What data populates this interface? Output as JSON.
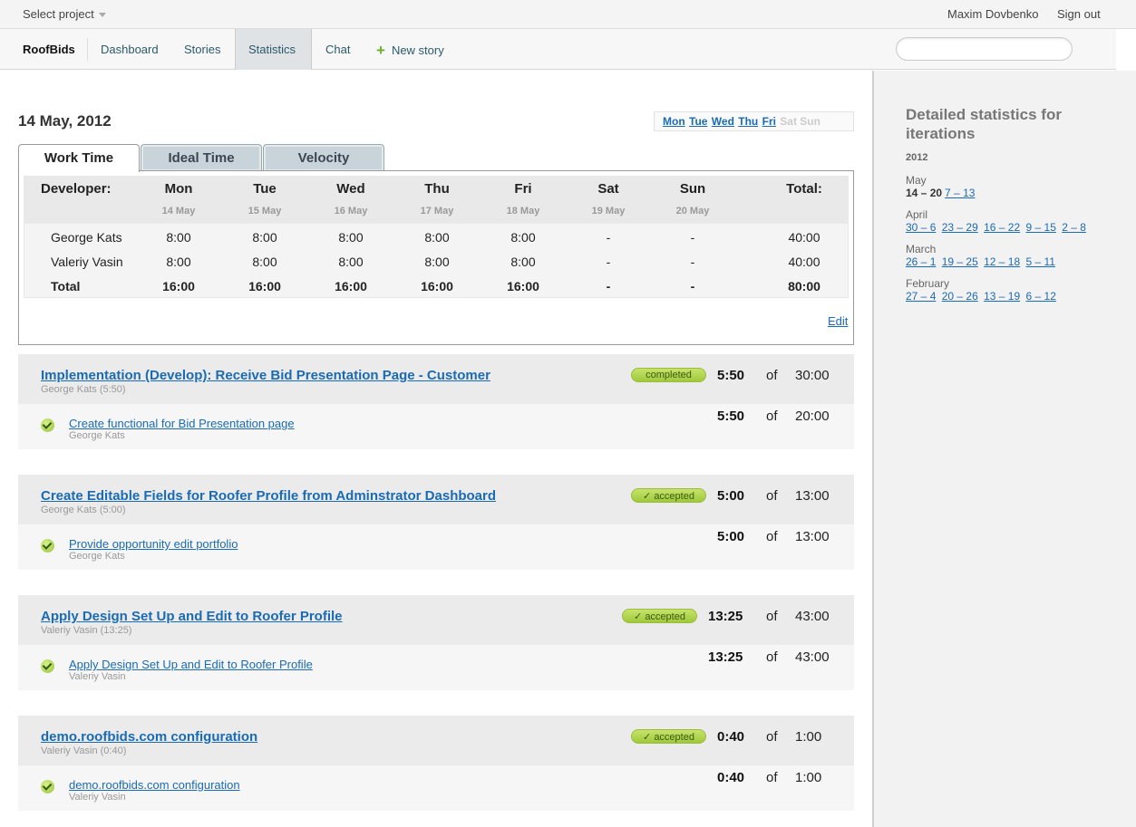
{
  "topbar": {
    "project_select": "Select project",
    "user": "Maxim Dovbenko",
    "signout": "Sign out"
  },
  "nav": {
    "brand": "RoofBids",
    "items": [
      "Dashboard",
      "Stories",
      "Statistics",
      "Chat"
    ],
    "new_story": "New story",
    "search_placeholder": ""
  },
  "main": {
    "date": "14 May, 2012",
    "days": {
      "on": [
        "Mon",
        "Tue",
        "Wed",
        "Thu",
        "Fri"
      ],
      "off": "Sat Sun"
    },
    "tabs": [
      "Work Time",
      "Ideal Time",
      "Velocity"
    ],
    "table": {
      "header": [
        "Developer:",
        "Mon",
        "Tue",
        "Wed",
        "Thu",
        "Fri",
        "Sat",
        "Sun",
        "Total:"
      ],
      "dates": [
        "14 May",
        "15 May",
        "16 May",
        "17 May",
        "18 May",
        "19 May",
        "20 May"
      ],
      "rows": [
        {
          "name": "George Kats",
          "values": [
            "8:00",
            "8:00",
            "8:00",
            "8:00",
            "8:00",
            "-",
            "-"
          ],
          "total": "40:00"
        },
        {
          "name": "Valeriy Vasin",
          "values": [
            "8:00",
            "8:00",
            "8:00",
            "8:00",
            "8:00",
            "-",
            "-"
          ],
          "total": "40:00"
        }
      ],
      "totals": {
        "label": "Total",
        "values": [
          "16:00",
          "16:00",
          "16:00",
          "16:00",
          "16:00",
          "-",
          "-"
        ],
        "total": "80:00"
      }
    },
    "edit": "Edit",
    "of": "of",
    "stories": [
      {
        "title": "Implementation (Develop): Receive Bid Presentation Page - Customer",
        "owner": "George Kats (5:50)",
        "status": "completed",
        "time": "5:50",
        "estimate": "30:00",
        "task": {
          "title": "Create functional for Bid Presentation page",
          "owner": "George Kats",
          "time": "5:50",
          "estimate": "20:00"
        }
      },
      {
        "title": "Create Editable Fields for Roofer Profile from Adminstrator Dashboard",
        "owner": "George Kats (5:00)",
        "status": "accepted",
        "time": "5:00",
        "estimate": "13:00",
        "task": {
          "title": "Provide opportunity edit portfolio",
          "owner": "George Kats",
          "time": "5:00",
          "estimate": "13:00"
        }
      },
      {
        "title": "Apply Design Set Up and Edit to Roofer Profile",
        "owner": "Valeriy Vasin (13:25)",
        "status": "accepted",
        "time": "13:25",
        "estimate": "43:00",
        "task": {
          "title": "Apply Design Set Up and Edit to Roofer Profile",
          "owner": "Valeriy Vasin",
          "time": "13:25",
          "estimate": "43:00"
        }
      },
      {
        "title": "demo.roofbids.com configuration",
        "owner": "Valeriy Vasin (0:40)",
        "status": "accepted",
        "time": "0:40",
        "estimate": "1:00",
        "task": {
          "title": "demo.roofbids.com configuration",
          "owner": "Valeriy Vasin",
          "time": "0:40",
          "estimate": "1:00"
        }
      }
    ]
  },
  "sidebar": {
    "title": "Detailed statistics for iterations",
    "year": "2012",
    "months": [
      {
        "name": "May",
        "current": "14 – 20",
        "links": [
          "7 – 13"
        ]
      },
      {
        "name": "April",
        "links": [
          "30 – 6",
          "23 – 29",
          "16 – 22",
          "9 – 15",
          "2 – 8"
        ]
      },
      {
        "name": "March",
        "links": [
          "26 – 1",
          "19 – 25",
          "12 – 18",
          "5 – 11"
        ]
      },
      {
        "name": "February",
        "links": [
          "27 – 4",
          "20 – 26",
          "13 – 19",
          "6 – 12"
        ]
      }
    ]
  },
  "colors": {
    "link": "#1a6bb3",
    "badge": "#b5d955",
    "accent_plus": "#6bb22a"
  }
}
